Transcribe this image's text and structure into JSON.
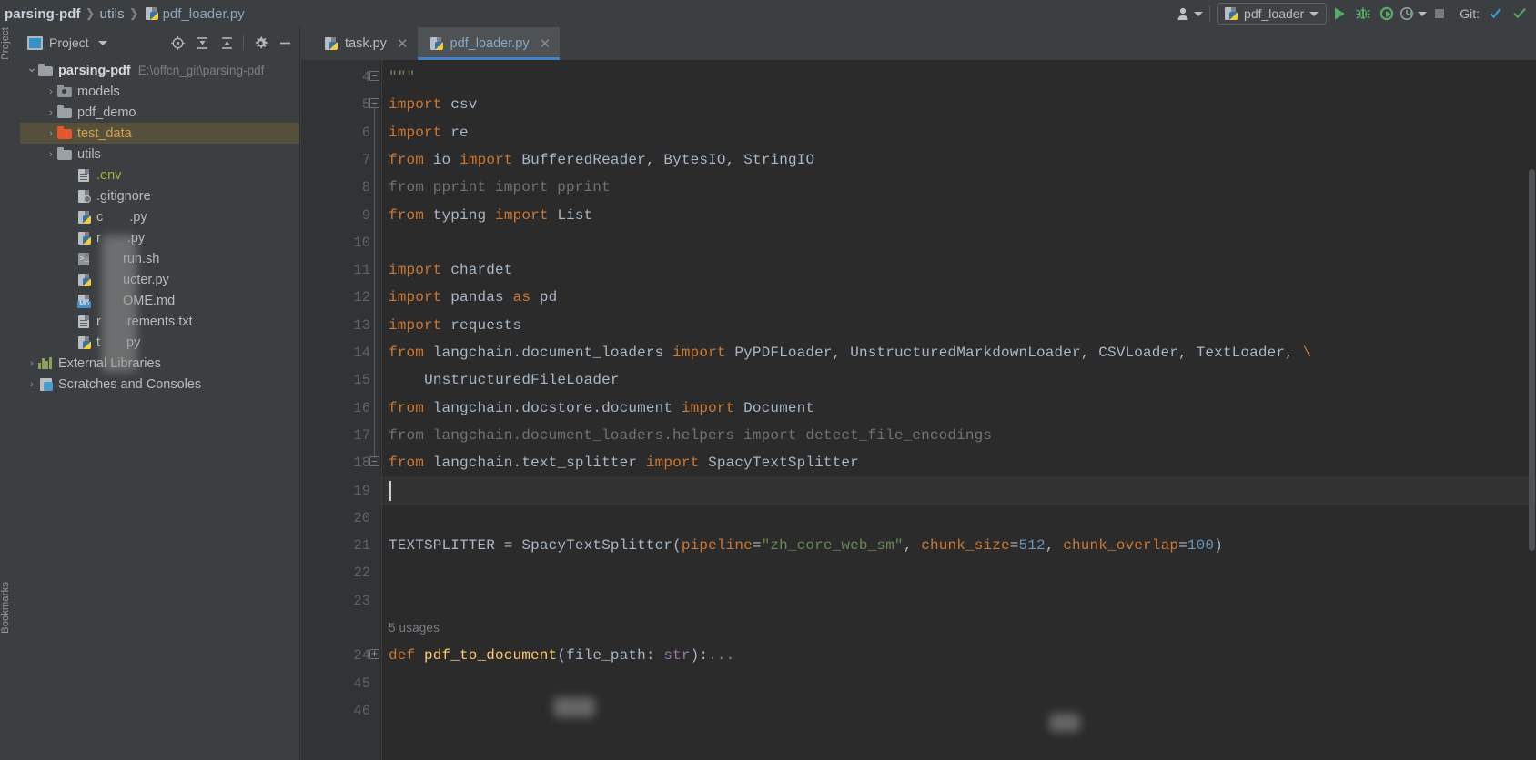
{
  "window": {
    "breadcrumb": [
      "parsing-pdf",
      "utils",
      "pdf_loader.py"
    ],
    "breadcrumb_file_icon": "python-file-icon"
  },
  "toolbar": {
    "account_icon": "user-account-icon",
    "run_config_name": "pdf_loader",
    "run_config_icon": "python-file-icon",
    "run_button": "run-icon",
    "debug_button": "debug-bug-icon",
    "coverage_button": "run-with-coverage-icon",
    "profile_button": "profile-icon",
    "stop_button": "stop-icon",
    "git_label": "Git:",
    "git_update_button": "git-update-project-icon",
    "git_commit_button": "git-commit-icon"
  },
  "left_strips": {
    "project": "Project",
    "bookmarks": "Bookmarks"
  },
  "project_panel": {
    "title": "Project",
    "tools": [
      {
        "name": "select-opened-file-icon",
        "label": "Select Opened File"
      },
      {
        "name": "expand-all-icon",
        "label": "Expand All"
      },
      {
        "name": "collapse-all-icon",
        "label": "Collapse All"
      },
      {
        "name": "settings-gear-icon",
        "label": "Settings"
      },
      {
        "name": "hide-panel-icon",
        "label": "Hide"
      }
    ],
    "tree": [
      {
        "label": "parsing-pdf",
        "path": "E:\\offcn_git\\parsing-pdf",
        "icon": "folder-icon",
        "indent": 0,
        "arrow": "expanded",
        "bold": true,
        "selected": false,
        "blurred": false
      },
      {
        "label": "models",
        "path": "",
        "icon": "source-folder-icon",
        "indent": 1,
        "arrow": "collapsed",
        "bold": false,
        "selected": false,
        "blurred": false
      },
      {
        "label": "pdf_demo",
        "path": "",
        "icon": "folder-icon",
        "indent": 1,
        "arrow": "collapsed",
        "bold": false,
        "selected": false,
        "blurred": false
      },
      {
        "label": "test_data",
        "path": "",
        "icon": "folder-excluded-icon",
        "indent": 1,
        "arrow": "collapsed",
        "bold": false,
        "selected": true,
        "blurred": false
      },
      {
        "label": "utils",
        "path": "",
        "icon": "folder-icon",
        "indent": 1,
        "arrow": "collapsed",
        "bold": false,
        "selected": false,
        "blurred": false
      },
      {
        "label": ".env",
        "path": "",
        "icon": "text-file-icon",
        "indent": 2,
        "arrow": "none",
        "bold": false,
        "selected": false,
        "blurred": false
      },
      {
        "label": ".gitignore",
        "path": "",
        "icon": "gitignore-file-icon",
        "indent": 2,
        "arrow": "none",
        "bold": false,
        "selected": false,
        "blurred": false
      },
      {
        "label": "c  .py",
        "path": "",
        "icon": "python-file-icon",
        "indent": 2,
        "arrow": "none",
        "bold": false,
        "selected": false,
        "blurred": true
      },
      {
        "label": "r  .py",
        "path": "",
        "icon": "python-file-icon",
        "indent": 2,
        "arrow": "none",
        "bold": false,
        "selected": false,
        "blurred": true
      },
      {
        "label": "  run.sh",
        "path": "",
        "icon": "shell-script-icon",
        "indent": 2,
        "arrow": "none",
        "bold": false,
        "selected": false,
        "blurred": true
      },
      {
        "label": "  ucter.py",
        "path": "",
        "icon": "python-file-icon",
        "indent": 2,
        "arrow": "none",
        "bold": false,
        "selected": false,
        "blurred": true
      },
      {
        "label": "  OME.md",
        "path": "",
        "icon": "markdown-file-icon",
        "indent": 2,
        "arrow": "none",
        "bold": false,
        "selected": false,
        "blurred": true
      },
      {
        "label": "r  rements.txt",
        "path": "",
        "icon": "text-file-icon",
        "indent": 2,
        "arrow": "none",
        "bold": false,
        "selected": false,
        "blurred": true
      },
      {
        "label": "t  py",
        "path": "",
        "icon": "python-file-icon",
        "indent": 2,
        "arrow": "none",
        "bold": false,
        "selected": false,
        "blurred": true
      },
      {
        "label": "External Libraries",
        "path": "",
        "icon": "external-libraries-icon",
        "indent": 0,
        "arrow": "collapsed",
        "bold": false,
        "selected": false,
        "blurred": false
      },
      {
        "label": "Scratches and Consoles",
        "path": "",
        "icon": "scratches-icon",
        "indent": 0,
        "arrow": "collapsed",
        "bold": false,
        "selected": false,
        "blurred": false
      }
    ]
  },
  "editor": {
    "tabs": [
      {
        "label": "task.py",
        "icon": "python-file-icon",
        "active": false,
        "closable": true
      },
      {
        "label": "pdf_loader.py",
        "icon": "python-file-icon",
        "active": true,
        "closable": true
      }
    ],
    "caret_line": 19,
    "inlay_hint": "5 usages",
    "lines": [
      {
        "num": "4",
        "text": "\"\"\""
      },
      {
        "num": "5",
        "text": "import csv"
      },
      {
        "num": "6",
        "text": "import re"
      },
      {
        "num": "7",
        "text": "from io import BufferedReader, BytesIO, StringIO"
      },
      {
        "num": "8",
        "text": "from pprint import pprint"
      },
      {
        "num": "9",
        "text": "from typing import List"
      },
      {
        "num": "10",
        "text": ""
      },
      {
        "num": "11",
        "text": "import chardet"
      },
      {
        "num": "12",
        "text": "import pandas as pd"
      },
      {
        "num": "13",
        "text": "import requests"
      },
      {
        "num": "14",
        "text": "from langchain.document_loaders import PyPDFLoader, UnstructuredMarkdownLoader, CSVLoader, TextLoader, \\"
      },
      {
        "num": "15",
        "text": "    UnstructuredFileLoader"
      },
      {
        "num": "16",
        "text": "from langchain.docstore.document import Document"
      },
      {
        "num": "17",
        "text": "from langchain.document_loaders.helpers import detect_file_encodings"
      },
      {
        "num": "18",
        "text": "from langchain.text_splitter import SpacyTextSplitter"
      },
      {
        "num": "19",
        "text": ""
      },
      {
        "num": "20",
        "text": ""
      },
      {
        "num": "21",
        "text": "TEXTSPLITTER = SpacyTextSplitter(pipeline=\"zh_core_web_sm\", chunk_size=512, chunk_overlap=100)"
      },
      {
        "num": "22",
        "text": ""
      },
      {
        "num": "23",
        "text": ""
      },
      {
        "num": "",
        "text": "5 usages"
      },
      {
        "num": "24",
        "text": "def pdf_to_document(file_path: str):..."
      },
      {
        "num": "45",
        "text": ""
      },
      {
        "num": "46",
        "text": ""
      }
    ]
  },
  "colors": {
    "background": "#2b2b2b",
    "chrome": "#3c3f41",
    "gutter": "#313335",
    "keyword": "#cc7832",
    "string": "#6a8759",
    "number": "#6897bb",
    "identifier": "#a9b7c6",
    "unused_grey": "#6f7376",
    "selection_amber": "#55503b",
    "tab_underline": "#3d84c7",
    "run_green": "#59a869"
  }
}
